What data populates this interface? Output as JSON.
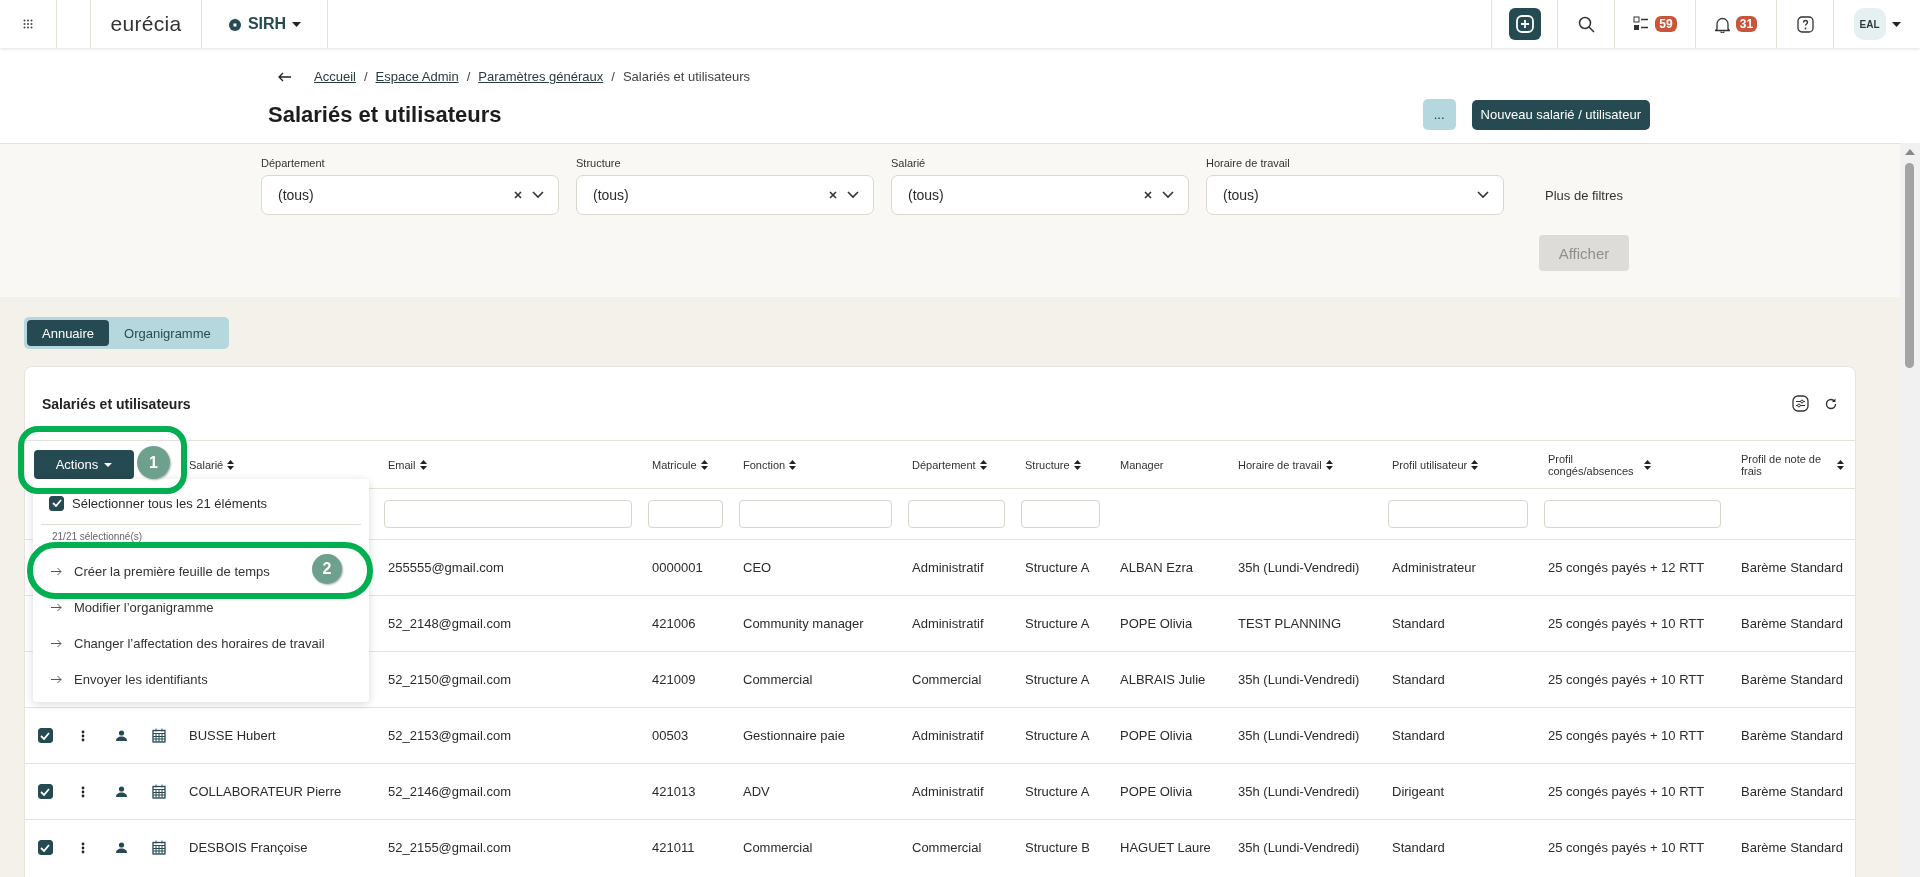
{
  "topbar": {
    "logo": "eurécia",
    "module": "SIRH",
    "tasks_count": "59",
    "notifications_count": "31",
    "avatar": "EAL"
  },
  "breadcrumb": [
    {
      "kind": "link",
      "label": "Accueil"
    },
    {
      "kind": "separator",
      "label": "/"
    },
    {
      "kind": "link",
      "label": "Espace Admin"
    },
    {
      "kind": "separator",
      "label": "/"
    },
    {
      "kind": "link",
      "label": "Paramètres généraux"
    },
    {
      "kind": "separator",
      "label": "/"
    },
    {
      "kind": "current",
      "label": "Salariés et utilisateurs"
    }
  ],
  "title": "Salariés et utilisateurs",
  "header_buttons": [
    {
      "label": "...",
      "kind": "secondary"
    },
    {
      "label": "Nouveau salarié / utilisateur",
      "kind": "primary"
    }
  ],
  "filters": [
    {
      "label": "Département",
      "value": "(tous)",
      "clearable": true
    },
    {
      "label": "Structure",
      "value": "(tous)",
      "clearable": true
    },
    {
      "label": "Salarié",
      "value": "(tous)",
      "clearable": true
    },
    {
      "label": "Horaire de travail",
      "value": "(tous)",
      "clearable": false
    }
  ],
  "more_filters": "Plus de filtres",
  "apply_button": {
    "label": "Afficher",
    "disabled": true
  },
  "view_tabs": [
    {
      "label": "Annuaire",
      "selected": true
    },
    {
      "label": "Organigramme",
      "selected": false
    }
  ],
  "card": {
    "title": "Salariés et utilisateurs",
    "actions_button": "Actions",
    "columns": [
      {
        "label": "Salarié",
        "sortable": true,
        "filter": false
      },
      {
        "label": "Email",
        "sortable": true,
        "filter": true
      },
      {
        "label": "Matricule",
        "sortable": true,
        "filter": true
      },
      {
        "label": "Fonction",
        "sortable": true,
        "filter": true
      },
      {
        "label": "Département",
        "sortable": true,
        "filter": true
      },
      {
        "label": "Structure",
        "sortable": true,
        "filter": true
      },
      {
        "label": "Manager",
        "sortable": false,
        "filter": false
      },
      {
        "label": "Horaire de travail",
        "sortable": true,
        "filter": false
      },
      {
        "label": "Profil utilisateur",
        "sortable": true,
        "filter": true
      },
      {
        "label": "Profil congés/absences",
        "sortable": true,
        "filter": true
      },
      {
        "label": "Profil de note de frais",
        "sortable": true,
        "filter": false
      }
    ],
    "rows": [
      {
        "cells": [
          "",
          "255555@gmail.com",
          "0000001",
          "CEO",
          "Administratif",
          "Structure A",
          "ALBAN Ezra",
          "35h (Lundi-Vendredi)",
          "Administrateur",
          "25 congés payés + 12 RTT",
          "Barème Standard"
        ]
      },
      {
        "cells": [
          "",
          "52_2148@gmail.com",
          "421006",
          "Community manager",
          "Administratif",
          "Structure A",
          "POPE Olivia",
          "TEST PLANNING",
          "Standard",
          "25 congés payés + 10 RTT",
          "Barème Standard"
        ]
      },
      {
        "cells": [
          "",
          "52_2150@gmail.com",
          "421009",
          "Commercial",
          "Commercial",
          "Structure A",
          "ALBRAIS Julie",
          "35h (Lundi-Vendredi)",
          "Standard",
          "25 congés payés + 10 RTT",
          "Barème Standard"
        ]
      },
      {
        "checked": true,
        "cells": [
          "BUSSE Hubert",
          "52_2153@gmail.com",
          "00503",
          "Gestionnaire paie",
          "Administratif",
          "Structure A",
          "POPE Olivia",
          "35h (Lundi-Vendredi)",
          "Standard",
          "25 congés payés + 10 RTT",
          "Barème Standard"
        ]
      },
      {
        "checked": true,
        "cells": [
          "COLLABORATEUR Pierre",
          "52_2146@gmail.com",
          "421013",
          "ADV",
          "Administratif",
          "Structure A",
          "POPE Olivia",
          "35h (Lundi-Vendredi)",
          "Dirigeant",
          "25 congés payés + 10 RTT",
          "Barème Standard"
        ]
      },
      {
        "checked": true,
        "cells": [
          "DESBOIS Françoise",
          "52_2155@gmail.com",
          "421011",
          "Commercial",
          "Commercial",
          "Structure B",
          "HAGUET Laure",
          "35h (Lundi-Vendredi)",
          "Standard",
          "25 congés payés + 10 RTT",
          "Barème Standard"
        ]
      }
    ],
    "actions_menu": {
      "select_all": {
        "label": "Sélectionner tous les 21 éléments",
        "checked": true
      },
      "count": "21/21 sélectionné(s)",
      "items": [
        "Créer la première feuille de temps",
        "Modifier l’organigramme",
        "Changer l’affectation des horaires de travail",
        "Envoyer les identifiants"
      ]
    }
  },
  "step_badges": [
    "1",
    "2"
  ]
}
